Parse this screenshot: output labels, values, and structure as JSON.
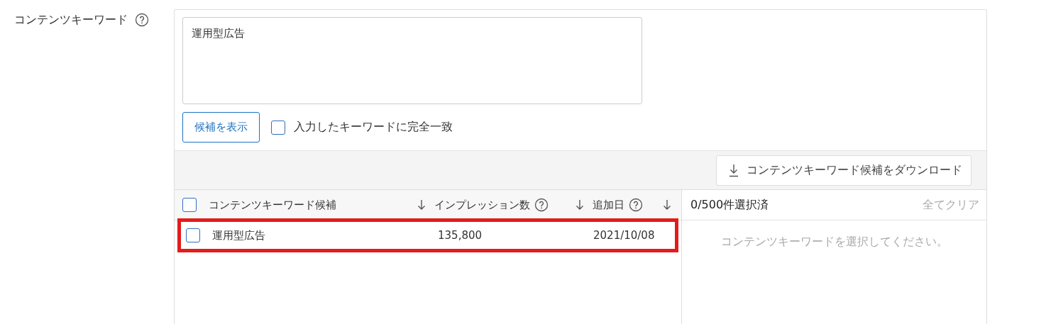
{
  "field": {
    "label": "コンテンツキーワード",
    "help": true
  },
  "keyword_input": {
    "value": "運用型広告"
  },
  "show_candidates_button": {
    "label": "候補を表示"
  },
  "exact_match": {
    "label": "入力したキーワードに完全一致",
    "checked": false
  },
  "download_button": {
    "label": "コンテンツキーワード候補をダウンロード"
  },
  "table": {
    "select_all": {
      "checked": false
    },
    "columns": [
      {
        "label": "コンテンツキーワード候補",
        "help": false,
        "sortable": true
      },
      {
        "label": "インプレッション数",
        "help": true,
        "sortable": true
      },
      {
        "label": "追加日",
        "help": true,
        "sortable": true
      }
    ],
    "rows": [
      {
        "checked": false,
        "highlighted": true,
        "cells": [
          "運用型広告",
          "135,800",
          "2021/10/08"
        ]
      }
    ]
  },
  "selection": {
    "count": "0/500件選択済",
    "clear": "全てクリア",
    "empty_message": "コンテンツキーワードを選択してください。"
  }
}
